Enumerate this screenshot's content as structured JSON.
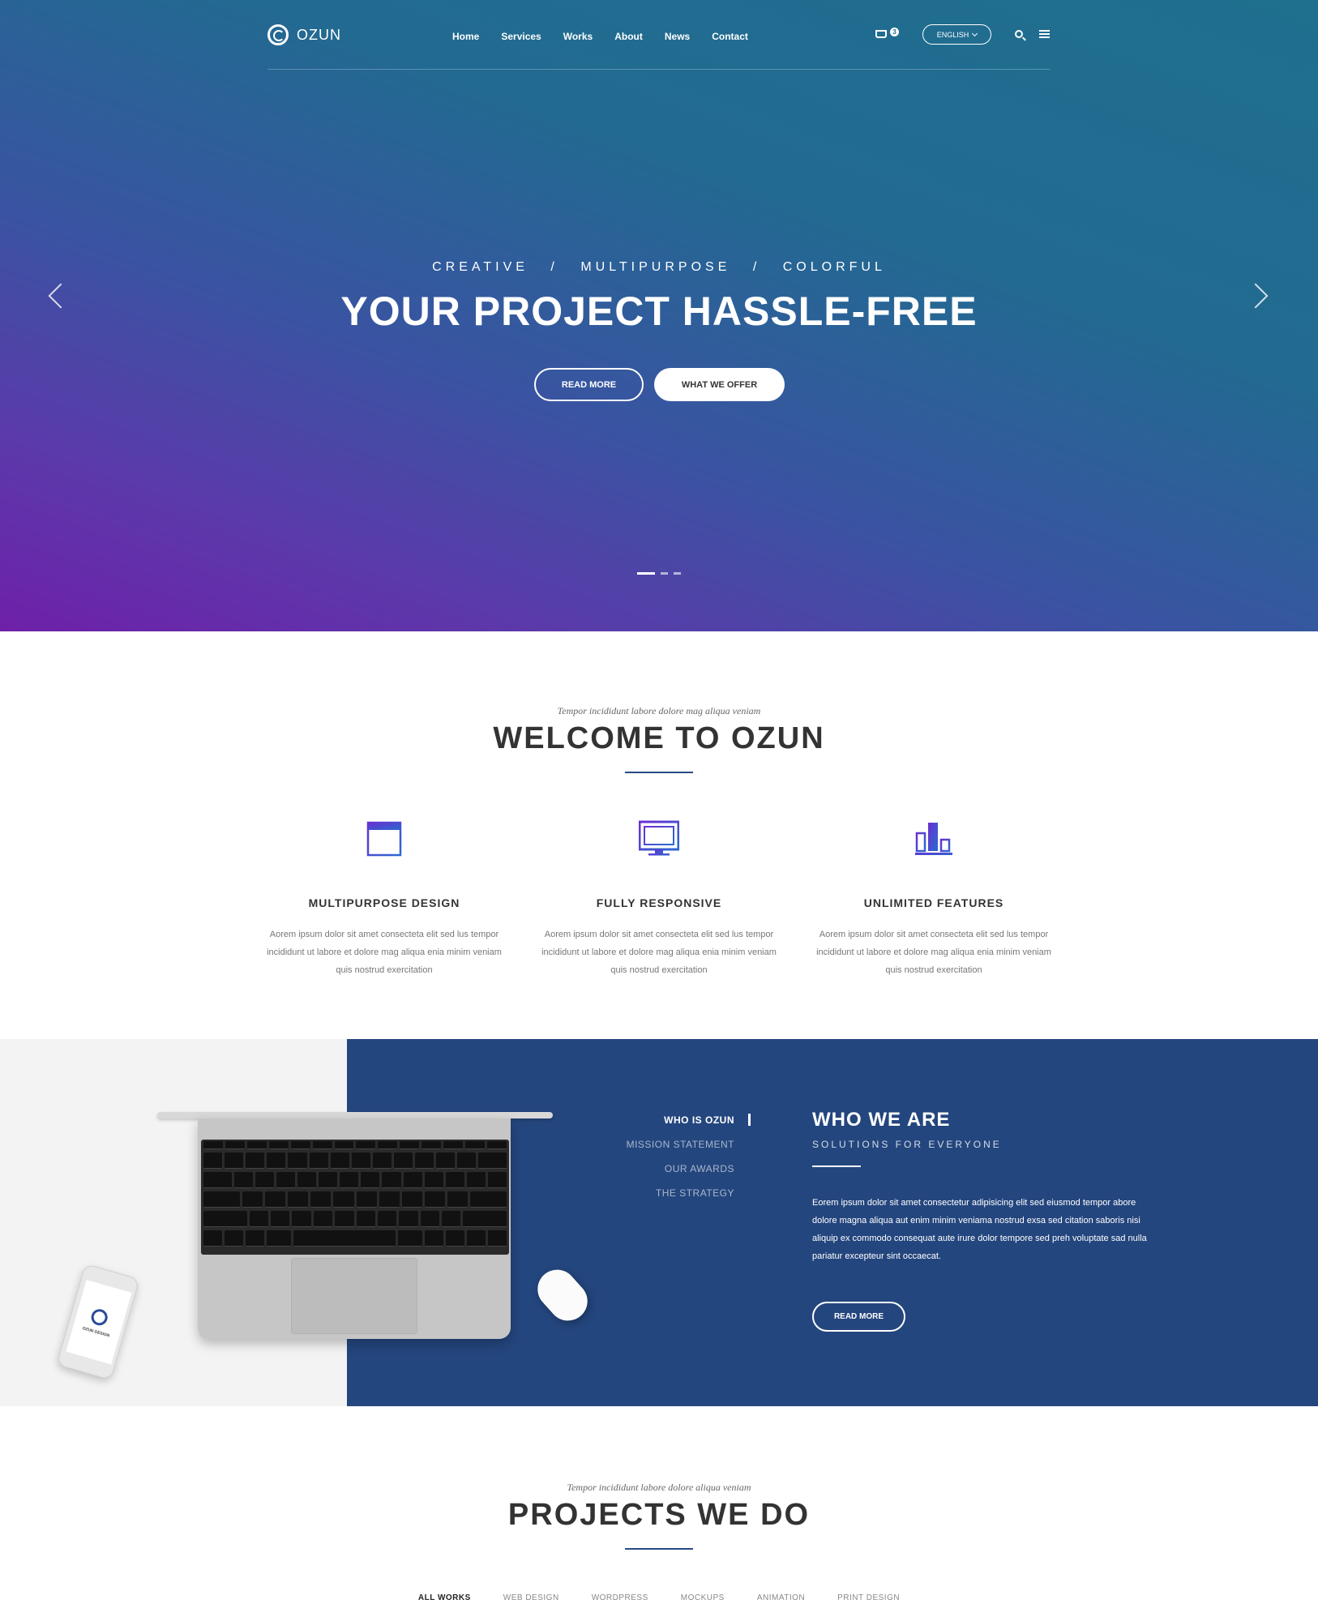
{
  "header": {
    "logo_text": "OZUN",
    "nav": [
      "Home",
      "Services",
      "Works",
      "About",
      "News",
      "Contact"
    ],
    "cart_count": "3",
    "language": "ENGLISH"
  },
  "hero": {
    "subtitle_parts": [
      "CREATIVE",
      "MULTIPURPOSE",
      "COLORFUL"
    ],
    "separator": "/",
    "title": "YOUR PROJECT HASSLE-FREE",
    "read_more": "READ MORE",
    "what_we_offer": "WHAT WE OFFER"
  },
  "welcome": {
    "tagline": "Tempor incididunt labore dolore mag aliqua veniam",
    "title": "WELCOME TO OZUN",
    "features": [
      {
        "icon": "layout-icon",
        "title": "MULTIPURPOSE DESIGN",
        "text": "Aorem ipsum dolor sit amet consecteta elit sed lus tempor incididunt ut labore et dolore mag aliqua enia minim veniam quis nostrud exercitation"
      },
      {
        "icon": "monitor-icon",
        "title": "FULLY RESPONSIVE",
        "text": "Aorem ipsum dolor sit amet consecteta elit sed lus tempor incididunt ut labore et dolore mag aliqua enia minim veniam quis nostrud exercitation"
      },
      {
        "icon": "chart-bars-icon",
        "title": "UNLIMITED FEATURES",
        "text": "Aorem ipsum dolor sit amet consecteta elit sed lus tempor incididunt ut labore et dolore mag aliqua enia minim veniam quis nostrud exercitation"
      }
    ]
  },
  "who": {
    "tabs": [
      "WHO IS OZUN",
      "MISSION STATEMENT",
      "OUR AWARDS",
      "THE STRATEGY"
    ],
    "active_tab": 0,
    "title": "WHO WE ARE",
    "subtitle": "SOLUTIONS FOR EVERYONE",
    "text": "Eorem ipsum dolor sit amet consectetur adipisicing elit sed eiusmod tempor abore dolore magna aliqua aut enim minim veniama nostrud exsa sed citation saboris nisi aliquip ex commodo consequat aute irure dolor tempore sed preh voluptate sad nulla pariatur excepteur sint occaecat.",
    "button": "READ MORE",
    "phone_label": "OZUN DESIGN"
  },
  "projects": {
    "tagline": "Tempor incididunt labore dolore aliqua veniam",
    "title": "PROJECTS WE DO",
    "filters": [
      "ALL WORKS",
      "WEB DESIGN",
      "WORDPRESS",
      "MOCKUPS",
      "ANIMATION",
      "PRINT DESIGN"
    ],
    "active_filter": 0
  },
  "colors": {
    "hero_top": "#1f6f8f",
    "hero_bottom": "#6e20a9",
    "navy": "#24467e",
    "accent_icon": "#4a45d0"
  }
}
